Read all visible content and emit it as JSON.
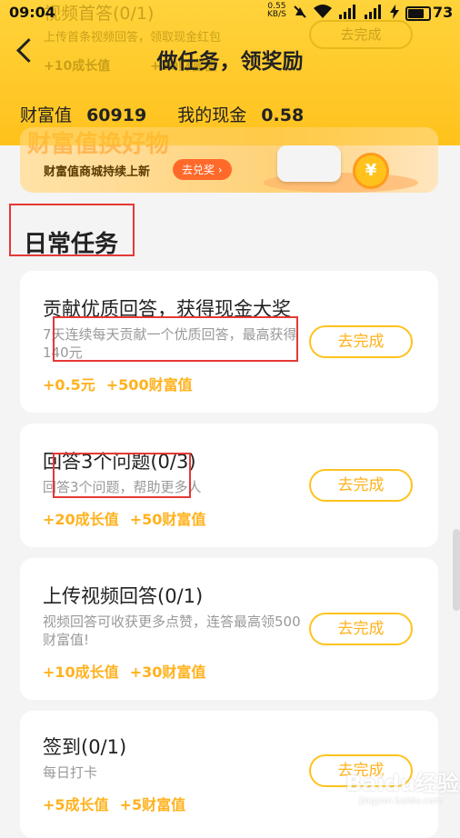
{
  "status_bar": {
    "time": "09:04",
    "net_speed": "0.55",
    "net_unit": "KB/S",
    "battery": "73"
  },
  "header": {
    "title": "做任务，领奖励",
    "wealth_label": "财富值",
    "wealth_value": "60919",
    "cash_label": "我的现金",
    "cash_value": "0.58"
  },
  "behind": {
    "task_title": "视频首答(0/1)",
    "task_desc": "上传首条视频回答，领取现金红包",
    "reward1": "+10成长值",
    "reward2": "+30财富值",
    "button": "去完成"
  },
  "banner": {
    "title": "财富值换好物",
    "subtitle": "财富值商城持续上新",
    "button": "去兑奖 ›",
    "coin": "¥"
  },
  "section": {
    "title": "日常任务"
  },
  "tasks": [
    {
      "title": "贡献优质回答，获得现金大奖",
      "desc": "7天连续每天贡献一个优质回答，最高获得140元",
      "reward1": "+0.5元",
      "reward2": "+500财富值",
      "button": "去完成"
    },
    {
      "title": "回答3个问题(0/3)",
      "desc": "回答3个问题，帮助更多人",
      "reward1": "+20成长值",
      "reward2": "+50财富值",
      "button": "去完成"
    },
    {
      "title": "上传视频回答(0/1)",
      "desc": "视频回答可收获更多点赞，连答最高领500财富值!",
      "reward1": "+10成长值",
      "reward2": "+30财富值",
      "button": "去完成"
    },
    {
      "title": "签到(0/1)",
      "desc": "每日打卡",
      "reward1": "+5成长值",
      "reward2": "+5财富值",
      "button": "去完成"
    }
  ],
  "watermark": {
    "text": "Baidu经验",
    "url": "jingyan.baidu.com"
  },
  "colors": {
    "header_yellow": "#ffc21d",
    "reward_orange": "#ffb21d",
    "highlight_red": "#e53935"
  }
}
